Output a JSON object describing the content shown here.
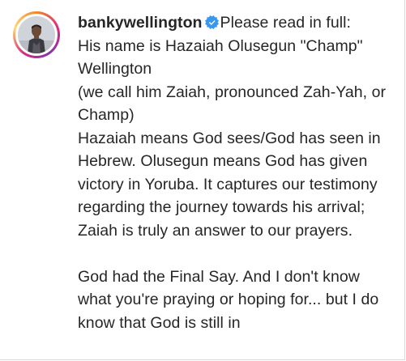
{
  "post": {
    "username": "bankywellington",
    "verified_icon": "verified-badge-icon",
    "badge_color": "#3897f0",
    "caption_lead": "Please read in full:",
    "caption_body": "His name is Hazaiah Olusegun \"Champ\" Wellington\n(we call him Zaiah, pronounced Zah-Yah, or Champ)\nHazaiah means God sees/God has seen in Hebrew. Olusegun means God has given victory in Yoruba. It captures our testimony regarding the journey towards his arrival; Zaiah is truly an answer to our prayers.\n\nGod had the Final Say. And I don't know what you're praying or hoping for... but I do know that God is still in"
  }
}
